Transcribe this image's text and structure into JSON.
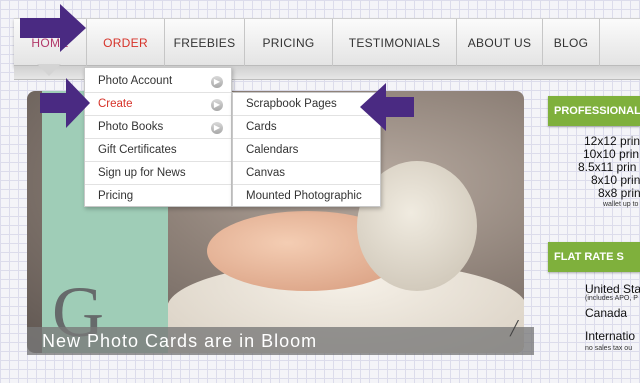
{
  "nav": {
    "home": "HOME",
    "order": "ORDER",
    "freebies": "FREEBIES",
    "pricing": "PRICING",
    "testimonials": "TESTIMONIALS",
    "about": "ABOUT US",
    "blog": "BLOG"
  },
  "order_menu": {
    "items": [
      "Photo Account",
      "Create",
      "Photo Books",
      "Gift Certificates",
      "Sign up for News",
      "Pricing"
    ]
  },
  "create_submenu": {
    "items": [
      "Scrapbook Pages",
      "Cards",
      "Calendars",
      "Canvas",
      "Mounted Photographic"
    ]
  },
  "hero": {
    "caption": "New Photo Cards are in Bloom",
    "panel_letter": "G"
  },
  "sidebar": {
    "professional_title": "PROFESSIONAL",
    "print_sizes": [
      "12x12 prin",
      "10x10 prin",
      "8.5x11 prin",
      "8x10 prin",
      "8x8 prin"
    ],
    "wallet_note": "wallet up to",
    "flat_rate_title": "FLAT RATE S",
    "shipping_1": "United Sta",
    "shipping_1_note": "(includes APO, P",
    "shipping_2": "Canada",
    "shipping_3": "Internatio",
    "shipping_3_note": "no sales tax ou"
  },
  "colors": {
    "accent_red": "#d6332a",
    "annotation_arrow": "#4a2a82",
    "ribbon_green": "#7fb03c",
    "panel_mint": "#9fcdb7"
  },
  "icons": {
    "submenu_arrow": "right-triangle",
    "annotation": "arrow",
    "caption_corner": "slash"
  }
}
